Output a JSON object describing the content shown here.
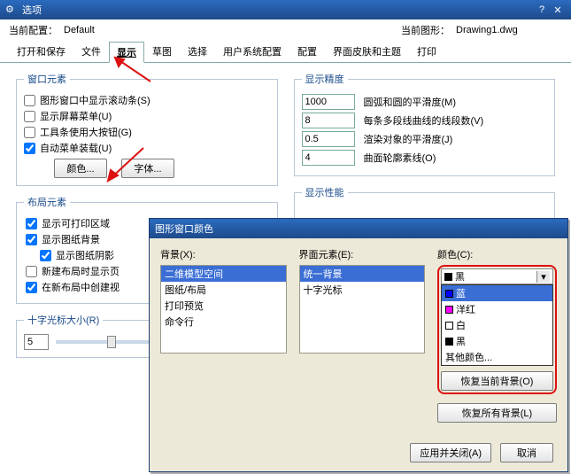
{
  "main": {
    "title": "选项",
    "labels": {
      "current_config": "当前配置：",
      "current_drawing": "当前图形："
    },
    "values": {
      "config": "Default",
      "drawing": "Drawing1.dwg"
    },
    "tabs": [
      "打开和保存",
      "文件",
      "显示",
      "草图",
      "选择",
      "用户系统配置",
      "配置",
      "界面皮肤和主题",
      "打印"
    ],
    "active_tab": 2,
    "groups": {
      "window_elements": {
        "legend": "窗口元素",
        "opts": [
          {
            "label": "图形窗口中显示滚动条(S)",
            "checked": false
          },
          {
            "label": "显示屏幕菜单(U)",
            "checked": false
          },
          {
            "label": "工具条使用大按钮(G)",
            "checked": false
          },
          {
            "label": "自动菜单装载(U)",
            "checked": true
          }
        ],
        "buttons": {
          "color": "颜色...",
          "font": "字体..."
        }
      },
      "display_precision": {
        "legend": "显示精度",
        "rows": [
          {
            "value": "1000",
            "label": "圆弧和圆的平滑度(M)"
          },
          {
            "value": "8",
            "label": "每条多段线曲线的线段数(V)"
          },
          {
            "value": "0.5",
            "label": "渲染对象的平滑度(J)"
          },
          {
            "value": "4",
            "label": "曲面轮廓素线(O)"
          }
        ]
      },
      "layout": {
        "legend": "布局元素",
        "opts": [
          {
            "label": "显示可打印区域",
            "checked": true,
            "sub": false
          },
          {
            "label": "显示图纸背景",
            "checked": true,
            "sub": false
          },
          {
            "label": "显示图纸阴影",
            "checked": true,
            "sub": true
          },
          {
            "label": "新建布局时显示页",
            "checked": false,
            "sub": false
          },
          {
            "label": "在新布局中创建视",
            "checked": true,
            "sub": false
          }
        ]
      },
      "display_perf": {
        "legend": "显示性能"
      },
      "cursor": {
        "legend": "十字光标大小(R)",
        "value": "5"
      }
    }
  },
  "sub": {
    "title": "图形窗口颜色",
    "labels": {
      "context": "背景(X):",
      "element": "界面元素(E):",
      "color": "颜色(C):"
    },
    "context_items": [
      "二维模型空间",
      "图纸/布局",
      "打印预览",
      "命令行"
    ],
    "element_items": [
      "统一背景",
      "十字光标"
    ],
    "current_color": {
      "name": "黑",
      "hex": "#000000"
    },
    "palette": [
      {
        "name": "蓝",
        "hex": "#0000ff",
        "sel": true
      },
      {
        "name": "洋红",
        "hex": "#ff00ff"
      },
      {
        "name": "白",
        "hex": "#ffffff"
      },
      {
        "name": "黑",
        "hex": "#000000"
      },
      {
        "name": "其他颜色...",
        "hex": null
      }
    ],
    "buttons": {
      "restore_current": "恢复当前背景(O)",
      "restore_all": "恢复所有背景(L)",
      "apply_close": "应用并关闭(A)",
      "cancel": "取消"
    }
  }
}
